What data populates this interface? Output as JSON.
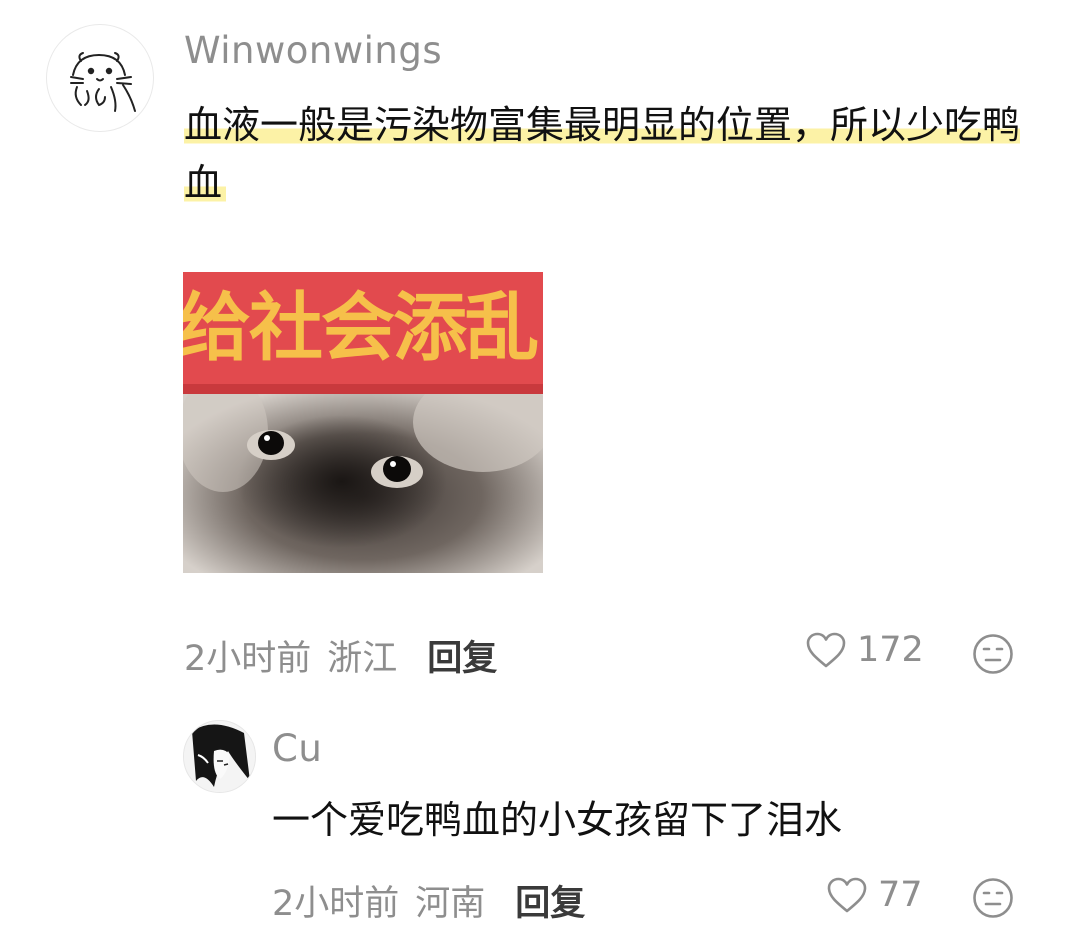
{
  "comment": {
    "username": "Winwonwings",
    "text_highlighted": "血液一般是污染物富集最明显的位置，所以少吃鸭血",
    "image": {
      "banner_text": "给社会添乱"
    },
    "meta": {
      "time": "2小时前",
      "location": "浙江",
      "reply_label": "回复"
    },
    "likes": "172"
  },
  "reply": {
    "username": "Cu",
    "text": "一个爱吃鸭血的小女孩留下了泪水",
    "meta": {
      "time": "2小时前",
      "location": "河南",
      "reply_label": "回复"
    },
    "likes": "77"
  },
  "colors": {
    "highlight": "#fcf096",
    "meta_text": "#8e8e8e",
    "banner_red": "#e24a4e",
    "banner_text": "#f6c04a"
  },
  "icons": [
    "otter-avatar",
    "anime-avatar",
    "heart-icon",
    "expressionless-emoji-icon"
  ]
}
